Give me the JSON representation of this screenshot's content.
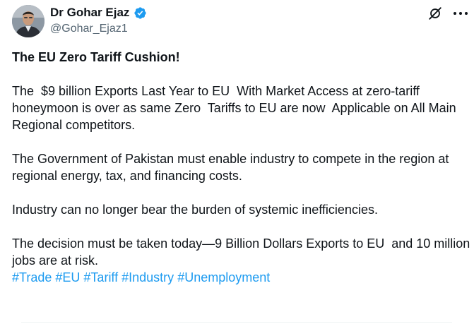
{
  "author": {
    "name": "Dr Gohar Ejaz",
    "handle": "@Gohar_Ejaz1",
    "verified": true,
    "verified_color": "#1d9bf0",
    "avatar_icon": "profile-photo"
  },
  "header_icons": {
    "grok": "grok-icon",
    "more": "more-options-icon"
  },
  "post": {
    "title": "The EU Zero Tariff Cushion!",
    "paragraph_1": "The  $9 billion Exports Last Year to EU  With Market Access at zero-tariff honeymoon is over as same Zero  Tariffs to EU are now  Applicable on All Main Regional competitors.",
    "paragraph_2": "The Government of Pakistan must enable industry to compete in the region at regional energy, tax, and financing costs.",
    "paragraph_3": "Industry can no longer bear the burden of systemic inefficiencies.",
    "paragraph_4": "The decision must be taken today—9 Billion Dollars Exports to EU  and 10 million jobs are at risk.",
    "hashtags": [
      "#Trade",
      "#EU",
      "#Tariff",
      "#Industry",
      "#Unemployment"
    ]
  },
  "colors": {
    "text": "#0f1419",
    "secondary": "#536471",
    "link": "#1d9bf0"
  }
}
